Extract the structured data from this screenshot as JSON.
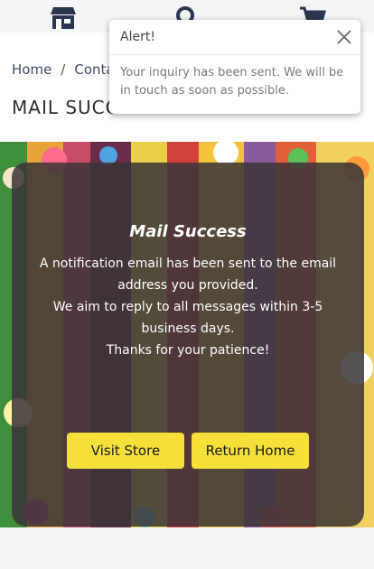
{
  "nav": {
    "icons": [
      "store-icon",
      "search-icon",
      "cart-icon"
    ]
  },
  "breadcrumb": {
    "home": "Home",
    "separator": "/",
    "current": "Conta"
  },
  "page": {
    "title": "MAIL SUCC"
  },
  "panel": {
    "title": "Mail Success",
    "lines": [
      "A notification email has been sent to the email",
      "address you provided.",
      "We aim to reply to all messages within 3-5",
      "business days.",
      "Thanks for your patience!"
    ],
    "visit_store_label": "Visit Store",
    "return_home_label": "Return Home"
  },
  "alert": {
    "title": "Alert!",
    "message": "Your inquiry has been sent. We will be in touch as soon as possible."
  },
  "colors": {
    "button": "#f5e03a",
    "panel": "#3a3438",
    "nav_icon": "#2a3550"
  }
}
